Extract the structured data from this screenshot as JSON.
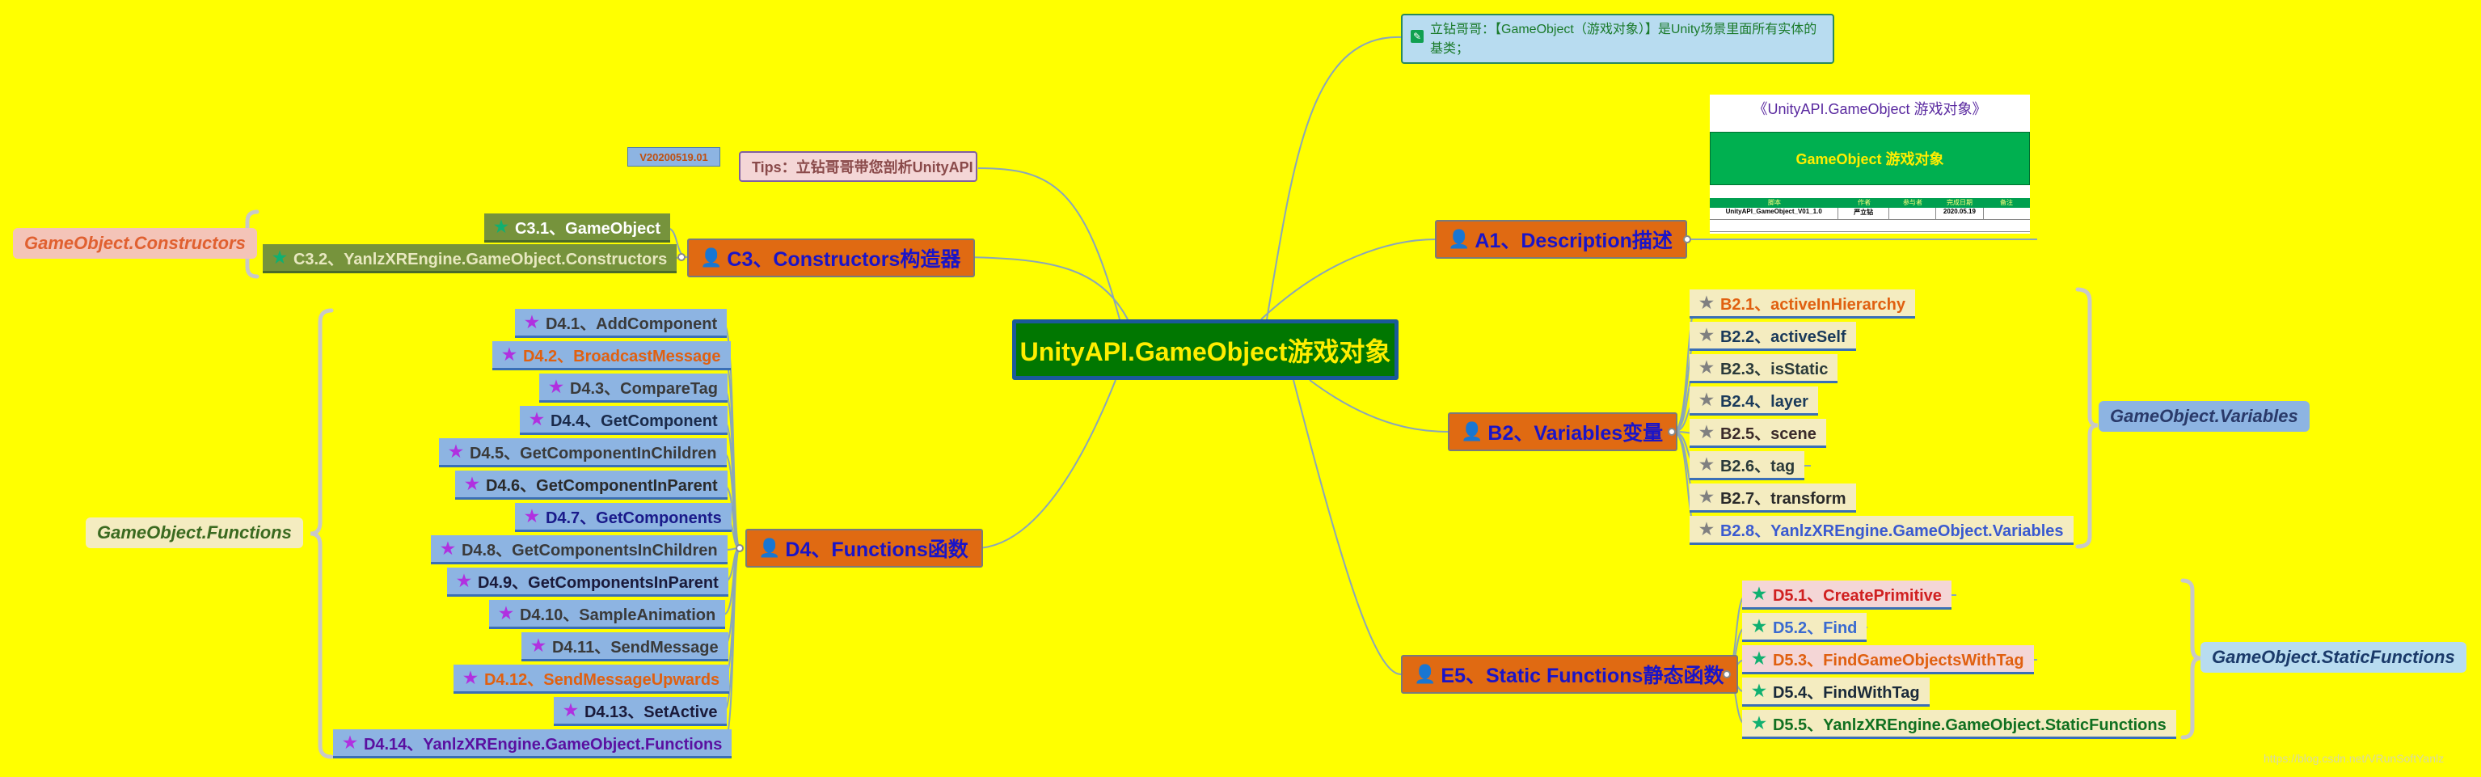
{
  "root": {
    "label": "UnityAPI.GameObject游戏对象"
  },
  "note": {
    "text": "立钻哥哥：【GameObject（游戏对象）】是Unity场景里面所有实体的基类；"
  },
  "doc": {
    "title": "《UnityAPI.GameObject 游戏对象》",
    "banner": "GameObject 游戏对象",
    "headers": [
      "脚本",
      "作者",
      "参与者",
      "完成日期",
      "备注"
    ],
    "row": [
      "UnityAPI_GameObject_V01_1.0",
      "严立钻",
      "",
      "2020.05.19",
      ""
    ]
  },
  "tips": {
    "version": "V20200519.01",
    "text": "Tips：立钻哥哥带您剖析UnityAPI"
  },
  "branches": {
    "a1": {
      "label": "A1、Description描述"
    },
    "b2": {
      "label": "B2、Variables变量",
      "group": "GameObject.Variables",
      "items": [
        "B2.1、activeInHierarchy",
        "B2.2、activeSelf",
        "B2.3、isStatic",
        "B2.4、layer",
        "B2.5、scene",
        "B2.6、tag",
        "B2.7、transform",
        "B2.8、YanlzXREngine.GameObject.Variables"
      ]
    },
    "c3": {
      "label": "C3、Constructors构造器",
      "group": "GameObject.Constructors",
      "items": [
        "C3.1、GameObject",
        "C3.2、YanlzXREngine.GameObject.Constructors"
      ]
    },
    "d4": {
      "label": "D4、Functions函数",
      "group": "GameObject.Functions",
      "items": [
        "D4.1、AddComponent",
        "D4.2、BroadcastMessage",
        "D4.3、CompareTag",
        "D4.4、GetComponent",
        "D4.5、GetComponentInChildren",
        "D4.6、GetComponentInParent",
        "D4.7、GetComponents",
        "D4.8、GetComponentsInChildren",
        "D4.9、GetComponentsInParent",
        "D4.10、SampleAnimation",
        "D4.11、SendMessage",
        "D4.12、SendMessageUpwards",
        "D4.13、SetActive",
        "D4.14、YanlzXREngine.GameObject.Functions"
      ]
    },
    "e5": {
      "label": "E5、Static Functions静态函数",
      "group": "GameObject.StaticFunctions",
      "items": [
        "D5.1、CreatePrimitive",
        "D5.2、Find",
        "D5.3、FindGameObjectsWithTag",
        "D5.4、FindWithTag",
        "D5.5、YanlzXREngine.GameObject.StaticFunctions"
      ]
    }
  },
  "watermark": "https://blog.csdn.net/VRunSoftYanlz",
  "colors": {
    "background": "#ffff00",
    "root": "#017701",
    "branch": "#e06a12",
    "leaf_blue": "#8db4e2"
  }
}
